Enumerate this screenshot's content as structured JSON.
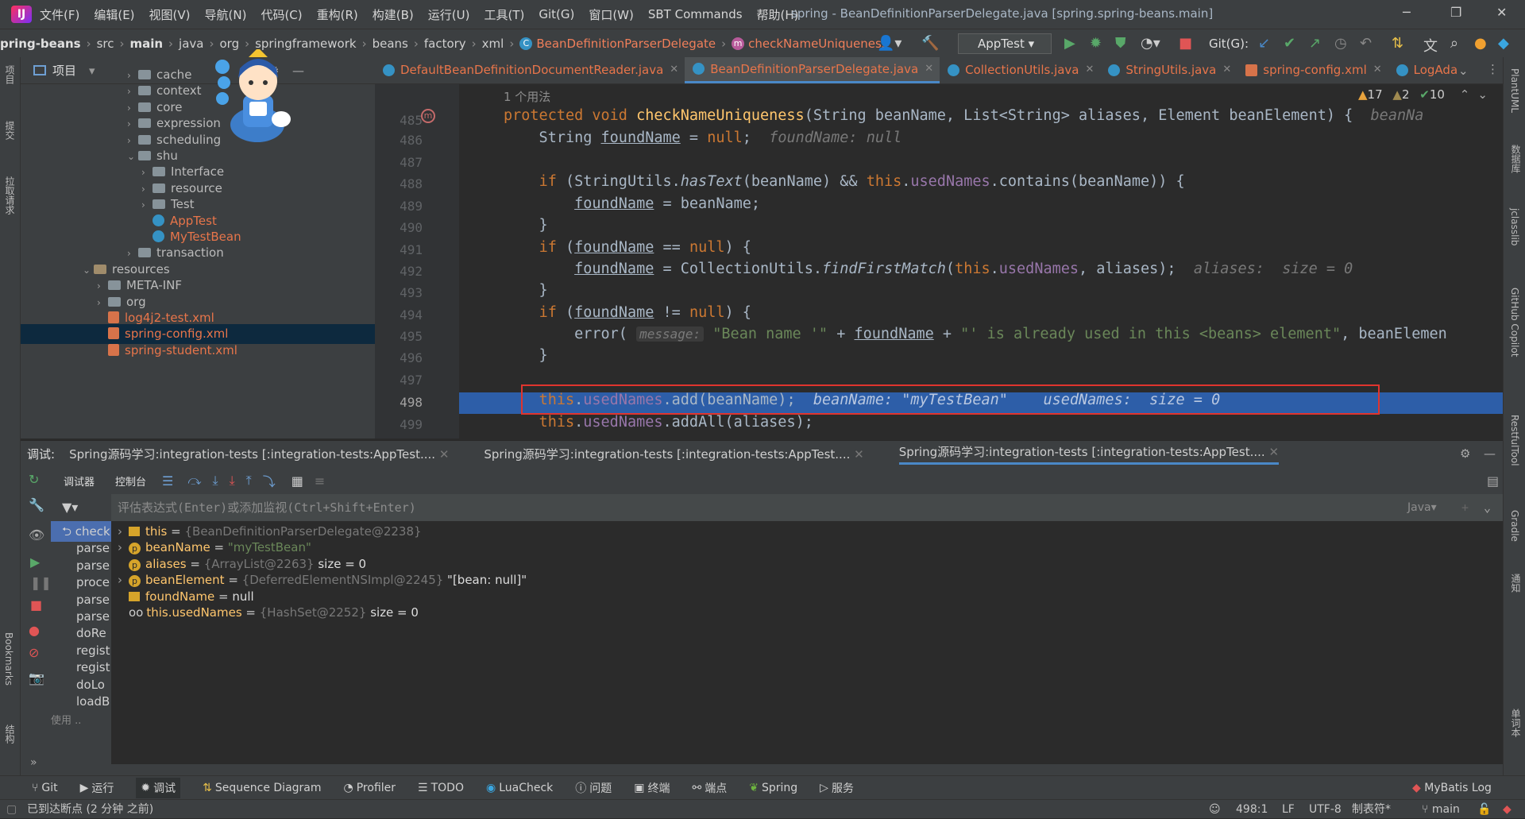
{
  "menu": {
    "items": [
      "文件(F)",
      "编辑(E)",
      "视图(V)",
      "导航(N)",
      "代码(C)",
      "重构(R)",
      "构建(B)",
      "运行(U)",
      "工具(T)",
      "Git(G)",
      "窗口(W)",
      "SBT Commands",
      "帮助(H)"
    ],
    "window_title": "spring - BeanDefinitionParserDelegate.java [spring.spring-beans.main]"
  },
  "nav": {
    "crumbs": [
      "pring-beans",
      "src",
      "main",
      "java",
      "org",
      "springframework",
      "beans",
      "factory",
      "xml"
    ],
    "class_crumb": "BeanDefinitionParserDelegate",
    "method_crumb": "checkNameUniqueness",
    "run_config": "AppTest",
    "git_label": "Git(G):"
  },
  "project": {
    "title": "项目",
    "rows": [
      {
        "label": "cache",
        "kind": "folder",
        "arrow": "›"
      },
      {
        "label": "context",
        "kind": "folder",
        "arrow": "›"
      },
      {
        "label": "core",
        "kind": "folder",
        "arrow": "›"
      },
      {
        "label": "expression",
        "kind": "folder",
        "arrow": "›"
      },
      {
        "label": "scheduling",
        "kind": "folder",
        "arrow": "›"
      },
      {
        "label": "shu",
        "kind": "folder",
        "arrow": "⌄"
      },
      {
        "label": "Interface",
        "kind": "folder",
        "arrow": "›"
      },
      {
        "label": "resource",
        "kind": "folder",
        "arrow": "›"
      },
      {
        "label": "Test",
        "kind": "folder",
        "arrow": "›"
      },
      {
        "label": "AppTest",
        "kind": "class",
        "arrow": ""
      },
      {
        "label": "MyTestBean",
        "kind": "class",
        "arrow": ""
      },
      {
        "label": "transaction",
        "kind": "folder",
        "arrow": "›"
      },
      {
        "label": "resources",
        "kind": "res",
        "arrow": "⌄"
      },
      {
        "label": "META-INF",
        "kind": "folder",
        "arrow": "›"
      },
      {
        "label": "org",
        "kind": "folder",
        "arrow": "›"
      },
      {
        "label": "log4j2-test.xml",
        "kind": "xml",
        "arrow": ""
      },
      {
        "label": "spring-config.xml",
        "kind": "xml",
        "arrow": ""
      },
      {
        "label": "spring-student.xml",
        "kind": "xml",
        "arrow": ""
      }
    ]
  },
  "tabs": [
    {
      "label": "DefaultBeanDefinitionDocumentReader.java"
    },
    {
      "label": "BeanDefinitionParserDelegate.java"
    },
    {
      "label": "CollectionUtils.java"
    },
    {
      "label": "StringUtils.java"
    },
    {
      "label": "spring-config.xml"
    },
    {
      "label": "LogAda"
    }
  ],
  "editor": {
    "usages": "1 个用法",
    "inspections": {
      "warn": "17",
      "weak": "2",
      "ok": "10"
    },
    "lines": [
      "485",
      "486",
      "487",
      "488",
      "489",
      "490",
      "491",
      "492",
      "493",
      "494",
      "495",
      "496",
      "497",
      "498",
      "499"
    ],
    "l485_sig": "checkNameUniqueness",
    "l485_rest": "(String beanName, List<String> aliases, Element beanElement) {",
    "l485_hint": "beanNa",
    "l486_hint": "foundName: null",
    "l492_hint": "aliases:  size = 0",
    "l495_param": "message:",
    "l495_str1": "\"Bean name '\"",
    "l495_str2": "\"' is already used in this <beans> element\"",
    "l495_tail": ", beanElemen",
    "l498_hint": "beanName: \"myTestBean\"    usedNames:  size = 0"
  },
  "debug": {
    "label": "调试:",
    "sessions": [
      "Spring源码学习:integration-tests [:integration-tests:AppTest....",
      "Spring源码学习:integration-tests [:integration-tests:AppTest....",
      "Spring源码学习:integration-tests [:integration-tests:AppTest...."
    ],
    "tool_tabs": [
      "调试器",
      "控制台"
    ],
    "eval_placeholder": "评估表达式(Enter)或添加监视(Ctrl+Shift+Enter)",
    "lang": "Java",
    "frames": [
      "check",
      "parse",
      "parse",
      "proce",
      "parse",
      "parse",
      "doRe",
      "regist",
      "regist",
      "doLo",
      "loadB"
    ],
    "frames_more": "使用 ..",
    "vars": [
      {
        "name": "this",
        "val": "{BeanDefinitionParserDelegate@2238}",
        "extra": "",
        "icon": "field",
        "expand": true
      },
      {
        "name": "beanName",
        "val": "\"myTestBean\"",
        "extra": "",
        "icon": "param",
        "expand": true
      },
      {
        "name": "aliases",
        "val": "{ArrayList@2263}",
        "extra": " size = 0",
        "icon": "param",
        "expand": false
      },
      {
        "name": "beanElement",
        "val": "{DeferredElementNSImpl@2245}",
        "extra": " \"[bean: null]\"",
        "icon": "param",
        "expand": true
      },
      {
        "name": "foundName",
        "val": "null",
        "extra": "",
        "icon": "field",
        "expand": false
      },
      {
        "name": "this.usedNames",
        "val": "{HashSet@2252}",
        "extra": " size = 0",
        "icon": "watch",
        "expand": false
      }
    ]
  },
  "bottom": {
    "items": [
      "Git",
      "运行",
      "调试",
      "Sequence Diagram",
      "Profiler",
      "TODO",
      "LuaCheck",
      "问题",
      "终端",
      "端点",
      "Spring",
      "服务"
    ],
    "right": "MyBatis Log"
  },
  "status": {
    "left": "已到达断点 (2 分钟 之前)",
    "pos": "498:1",
    "eol": "LF",
    "enc": "UTF-8",
    "indent": "制表符*",
    "branch": "main"
  },
  "side": {
    "left": [
      "项目",
      "提交",
      "拉取请求",
      "Bookmarks",
      "结构"
    ],
    "right": [
      "PlantUML",
      "数据库",
      "jclasslib",
      "GitHub Copilot",
      "RestfulTool",
      "Gradle",
      "通知",
      "单词本"
    ]
  },
  "colors": {
    "accent": "#4a88c7",
    "highlight": "#2d5ea8",
    "redbox": "#e0342e"
  }
}
